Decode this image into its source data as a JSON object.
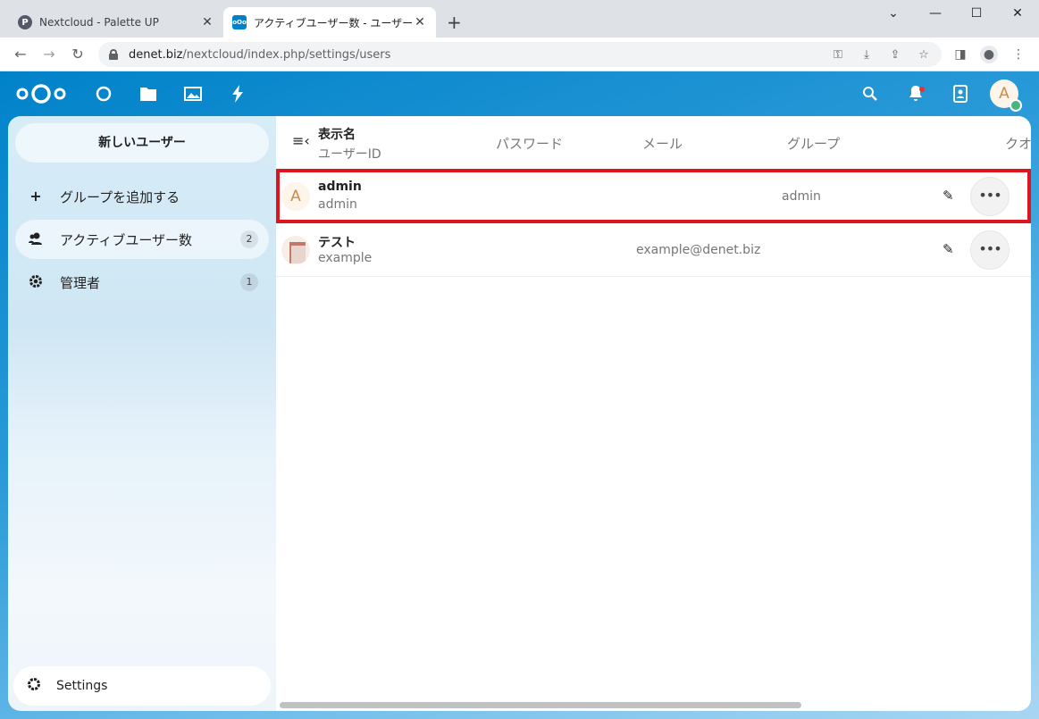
{
  "browser": {
    "tabs": [
      {
        "favicon": "P",
        "title": "Nextcloud - Palette UP",
        "active": false
      },
      {
        "favicon": "oOo",
        "title": "アクティブユーザー数 - ユーザー - ユーザー",
        "active": true
      }
    ],
    "url_host": "denet.biz",
    "url_path": "/nextcloud/index.php/settings/users",
    "window_controls": [
      "minimize-icon",
      "maximize-icon",
      "close-icon"
    ]
  },
  "header": {
    "apps": [
      "dashboard-icon",
      "files-icon",
      "photos-icon",
      "activity-icon"
    ],
    "avatar_letter": "A",
    "accent": "#0082c9"
  },
  "sidebar": {
    "new_user_label": "新しいユーザー",
    "items": [
      {
        "icon": "plus-icon",
        "label": "グループを追加する",
        "count": ""
      },
      {
        "icon": "users-icon",
        "label": "アクティブユーザー数",
        "count": "2"
      },
      {
        "icon": "admin-gear-icon",
        "label": "管理者",
        "count": "1"
      }
    ],
    "settings_label": "Settings"
  },
  "table": {
    "headers": {
      "display_name": "表示名",
      "user_id": "ユーザーID",
      "password": "パスワード",
      "email": "メール",
      "groups": "グループ",
      "quota": "クオ"
    },
    "rows": [
      {
        "avatar": "A",
        "name": "admin",
        "id": "admin",
        "email": "",
        "groups": "admin"
      },
      {
        "avatar": "",
        "name": "テスト",
        "id": "example",
        "email": "example@denet.biz",
        "groups": ""
      }
    ],
    "highlight_color": "#e0141e"
  }
}
